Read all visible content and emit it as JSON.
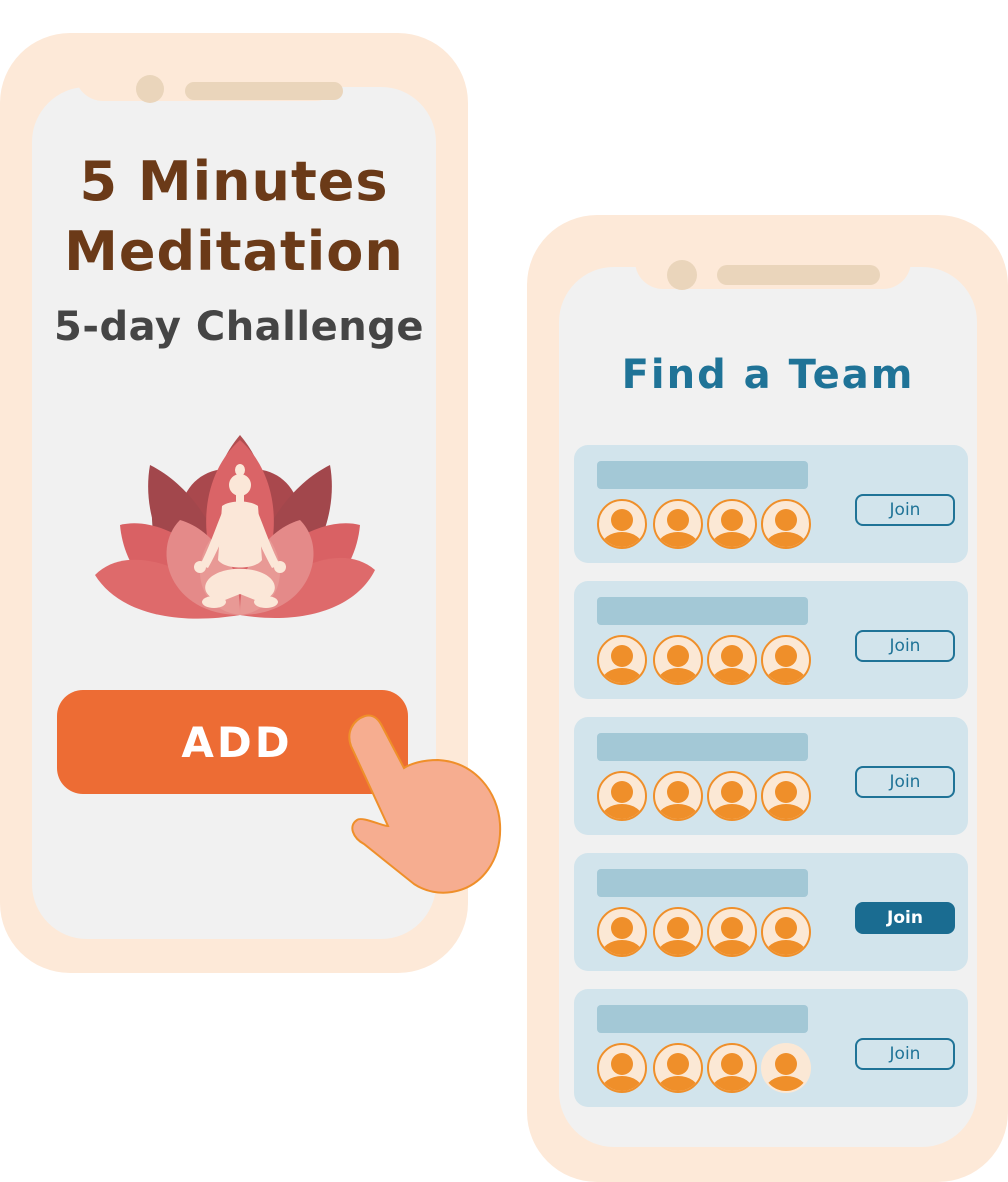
{
  "left_phone": {
    "title_line_1": "5 Minutes",
    "title_line_2": "Meditation",
    "subtitle": "5-day Challenge",
    "illustration": "lotus-meditation-icon",
    "add_button_label": "ADD",
    "pointer": "hand-pointer-icon"
  },
  "right_phone": {
    "title": "Find a Team",
    "teams": [
      {
        "join_label": "Join",
        "selected": false,
        "members_filled": 4
      },
      {
        "join_label": "Join",
        "selected": false,
        "members_filled": 4
      },
      {
        "join_label": "Join",
        "selected": false,
        "members_filled": 4
      },
      {
        "join_label": "Join",
        "selected": true,
        "members_filled": 4
      },
      {
        "join_label": "Join",
        "selected": false,
        "members_filled": 3
      }
    ]
  },
  "colors": {
    "phone_frame": "#fde9d8",
    "screen": "#f1f1f1",
    "title_brown": "#6b3a18",
    "accent_orange": "#ed6c34",
    "team_blue": "#1f7397",
    "card_bg": "#d2e4ec",
    "avatar_orange": "#ef8f2a"
  }
}
